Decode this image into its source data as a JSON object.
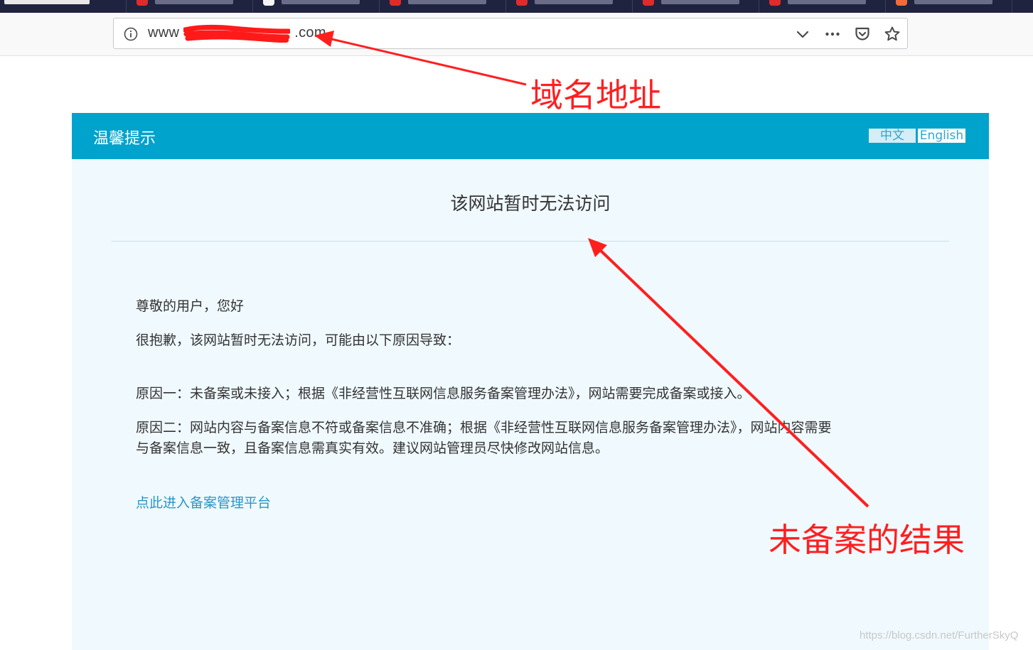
{
  "browser": {
    "tab_count": 8,
    "url_prefix": "www",
    "url_suffix": ".com",
    "icons": [
      "info-icon",
      "chevron-down-icon",
      "more-icon",
      "pocket-icon",
      "star-icon"
    ]
  },
  "notice": {
    "header_title": "温馨提示",
    "lang_chinese": "中文",
    "lang_english": "English",
    "heading": "该网站暂时无法访问",
    "greeting": "尊敬的用户，您好",
    "apology": "很抱歉，该网站暂时无法访问，可能由以下原因导致：",
    "reason_one": "原因一：未备案或未接入；根据《非经营性互联网信息服务备案管理办法》，网站需要完成备案或接入。",
    "reason_two_line1": "原因二：网站内容与备案信息不符或备案信息不准确；根据《非经营性互联网信息服务备案管理办法》，网站内容需要",
    "reason_two_line2": "与备案信息一致，且备案信息需真实有效。建议网站管理员尽快修改网站信息。",
    "platform_link": "点此进入备案管理平台"
  },
  "annotations": {
    "domain_label": "域名地址",
    "result_label": "未备案的结果",
    "color": "#ff1f1f"
  },
  "watermark": "https://blog.csdn.net/FurtherSkyQ",
  "colors": {
    "header_bg": "#00a3cc",
    "panel_bg": "#f0f9fe",
    "link": "#2796c9"
  }
}
